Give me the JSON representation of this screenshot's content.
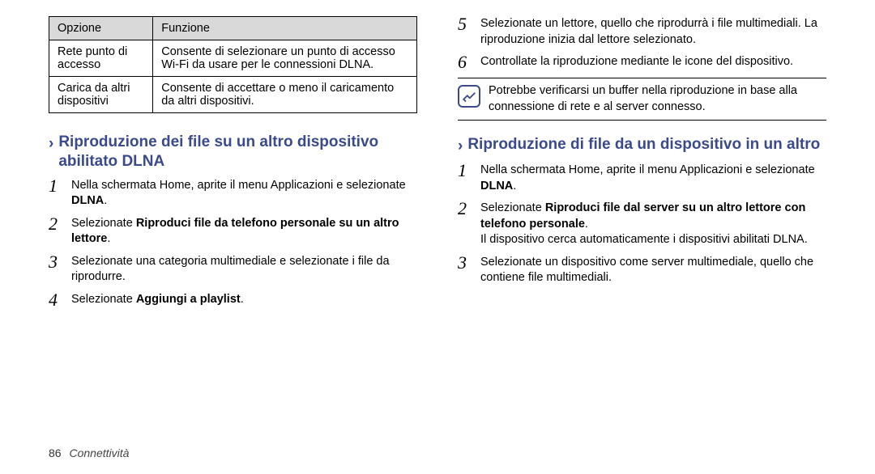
{
  "table": {
    "headers": [
      "Opzione",
      "Funzione"
    ],
    "rows": [
      [
        "Rete punto di accesso",
        "Consente di selezionare un punto di accesso Wi-Fi da usare per le connessioni DLNA."
      ],
      [
        "Carica da altri dispositivi",
        "Consente di accettare o meno il caricamento da altri dispositivi."
      ]
    ]
  },
  "left": {
    "heading": "Riproduzione dei file su un altro dispositivo abilitato DLNA",
    "steps": [
      {
        "n": "1",
        "pre": "Nella schermata Home, aprite il menu Applicazioni e selezionate ",
        "bold": "DLNA",
        "post": "."
      },
      {
        "n": "2",
        "pre": "Selezionate ",
        "bold": "Riproduci file da telefono personale su un altro lettore",
        "post": "."
      },
      {
        "n": "3",
        "pre": "Selezionate una categoria multimediale e selezionate i file da riprodurre.",
        "bold": "",
        "post": ""
      },
      {
        "n": "4",
        "pre": "Selezionate ",
        "bold": "Aggiungi a playlist",
        "post": "."
      }
    ]
  },
  "right": {
    "topSteps": [
      {
        "n": "5",
        "pre": "Selezionate un lettore, quello che riprodurrà i file multimediali. La riproduzione inizia dal lettore selezionato.",
        "bold": "",
        "post": ""
      },
      {
        "n": "6",
        "pre": "Controllate la riproduzione mediante le icone del dispositivo.",
        "bold": "",
        "post": ""
      }
    ],
    "note": "Potrebbe verificarsi un buffer nella riproduzione in base alla connessione di rete e al server connesso.",
    "heading": "Riproduzione di file da un dispositivo in un altro",
    "steps": [
      {
        "n": "1",
        "pre": "Nella schermata Home, aprite il menu Applicazioni e selezionate ",
        "bold": "DLNA",
        "post": "."
      },
      {
        "n": "2",
        "pre": "Selezionate ",
        "bold": "Riproduci file dal server su un altro lettore con telefono personale",
        "post": ".",
        "tail": "Il dispositivo cerca automaticamente i dispositivi abilitati DLNA."
      },
      {
        "n": "3",
        "pre": "Selezionate un dispositivo come server multimediale, quello che contiene file multimediali.",
        "bold": "",
        "post": ""
      }
    ]
  },
  "footer": {
    "page": "86",
    "section": "Connettività"
  }
}
